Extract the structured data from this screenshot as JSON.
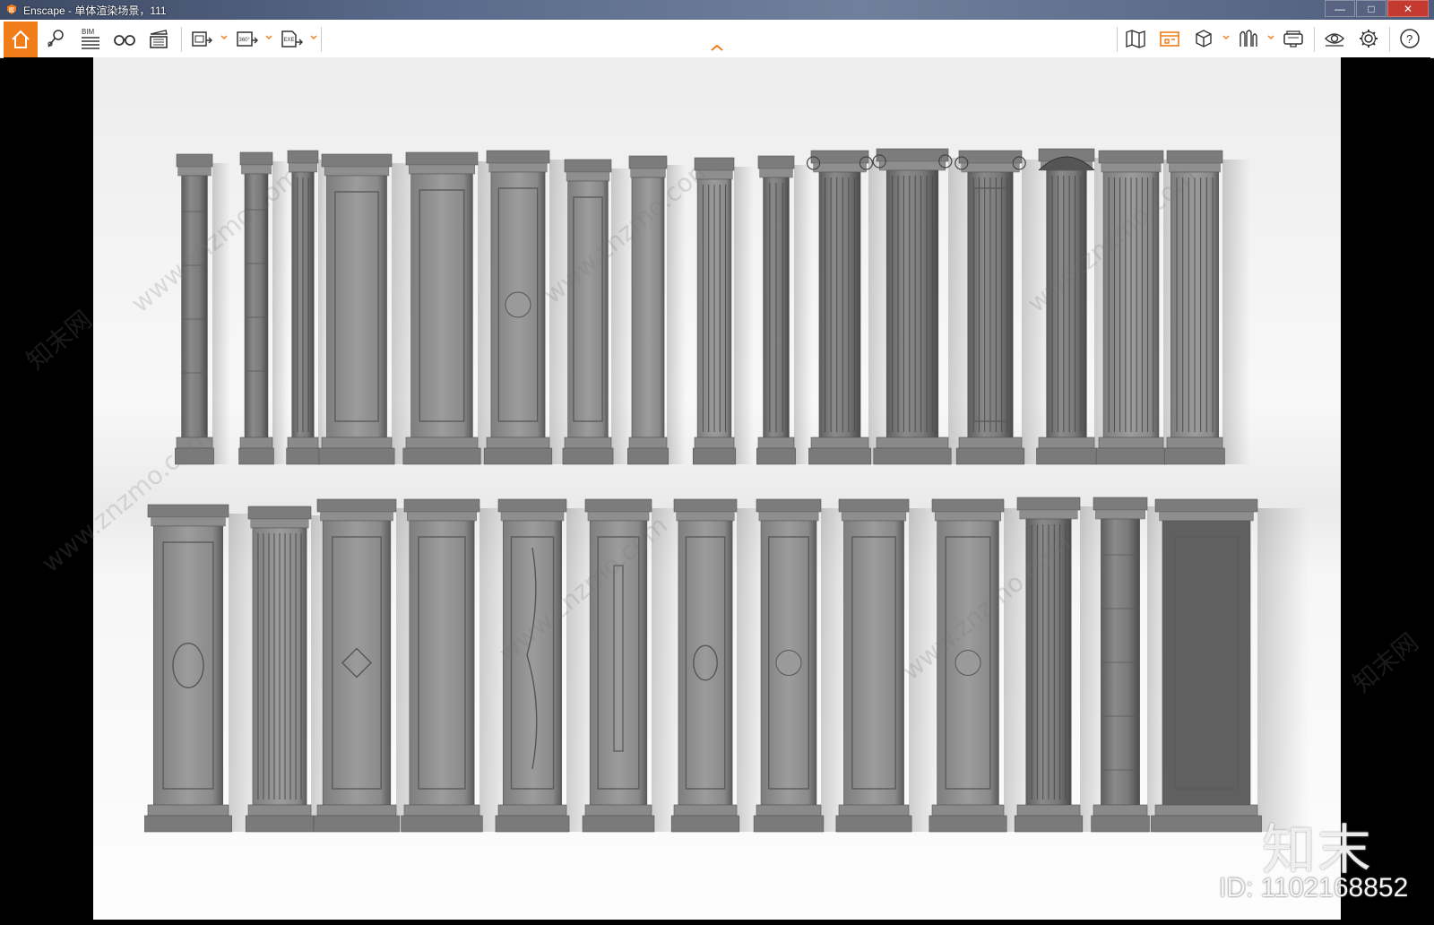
{
  "window": {
    "title": "Enscape - 单体渲染场景，111",
    "controls": {
      "minimize": "—",
      "maximize": "□",
      "close": "✕"
    }
  },
  "toolbar": {
    "left_icons": [
      "home-icon",
      "location-pin-icon",
      "bim-icon",
      "binoculars-icon",
      "clapperboard-icon",
      "screenshot-export-icon",
      "panorama-360-icon",
      "exe-export-icon"
    ],
    "bim_label": "BIM",
    "panorama_label": "360°",
    "exe_label": "EXE",
    "right_icons": [
      "map-icon",
      "asset-library-icon",
      "cube-icon",
      "material-icon",
      "vr-headset-icon",
      "visibility-icon",
      "settings-icon",
      "help-icon"
    ],
    "accent_color": "#f07d19"
  },
  "render": {
    "watermark_text": "www.znzmo.com",
    "watermark_cn": "知末网",
    "logo_text": "知末",
    "id_text": "ID: 1102168852"
  }
}
